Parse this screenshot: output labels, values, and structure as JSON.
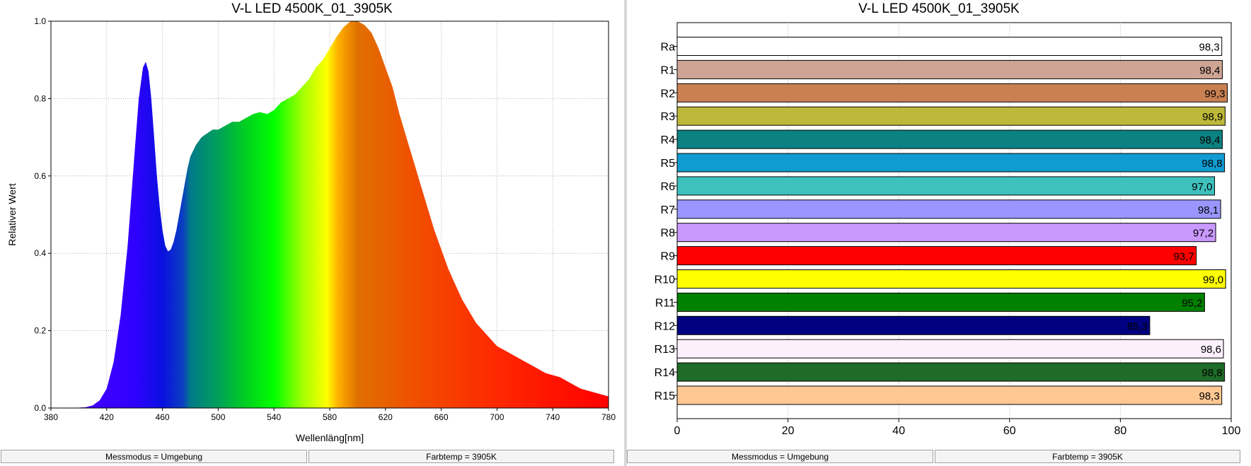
{
  "left": {
    "status1": "Messmodus = Umgebung",
    "status2": "Farbtemp = 3905K"
  },
  "right": {
    "status1": "Messmodus = Umgebung",
    "status2": "Farbtemp = 3905K"
  },
  "chart_data": [
    {
      "type": "area",
      "title": "V-L LED 4500K_01_3905K",
      "xlabel": "Wellenläng[nm]",
      "ylabel": "Relativer Wert",
      "xlim": [
        380,
        780
      ],
      "ylim": [
        0,
        1.0
      ],
      "xticks": [
        380,
        420,
        460,
        500,
        540,
        580,
        620,
        660,
        700,
        740,
        780
      ],
      "yticks": [
        "0.0",
        "0.2",
        "0.4",
        "0.6",
        "0.8",
        "1.0"
      ],
      "grid": true,
      "x": [
        380,
        395,
        405,
        410,
        415,
        420,
        425,
        430,
        435,
        440,
        443,
        446,
        448,
        450,
        452,
        454,
        456,
        458,
        460,
        462,
        464,
        466,
        468,
        470,
        472,
        474,
        476,
        478,
        480,
        484,
        488,
        492,
        496,
        500,
        505,
        510,
        515,
        520,
        525,
        530,
        535,
        540,
        545,
        550,
        555,
        560,
        565,
        570,
        575,
        580,
        585,
        590,
        595,
        600,
        605,
        610,
        615,
        620,
        625,
        630,
        635,
        640,
        645,
        650,
        655,
        660,
        665,
        670,
        675,
        680,
        685,
        690,
        695,
        700,
        705,
        710,
        715,
        720,
        725,
        730,
        735,
        740,
        745,
        750,
        755,
        760,
        765,
        770,
        775,
        780
      ],
      "values": [
        0.0,
        0.0,
        0.002,
        0.007,
        0.02,
        0.05,
        0.12,
        0.24,
        0.42,
        0.66,
        0.8,
        0.88,
        0.895,
        0.87,
        0.8,
        0.7,
        0.6,
        0.52,
        0.46,
        0.42,
        0.405,
        0.41,
        0.43,
        0.46,
        0.5,
        0.54,
        0.58,
        0.62,
        0.65,
        0.68,
        0.7,
        0.71,
        0.72,
        0.72,
        0.73,
        0.74,
        0.74,
        0.75,
        0.76,
        0.765,
        0.76,
        0.77,
        0.79,
        0.8,
        0.81,
        0.83,
        0.85,
        0.88,
        0.9,
        0.93,
        0.96,
        0.985,
        1.0,
        1.0,
        0.99,
        0.97,
        0.93,
        0.88,
        0.83,
        0.76,
        0.7,
        0.64,
        0.58,
        0.52,
        0.46,
        0.41,
        0.36,
        0.32,
        0.28,
        0.25,
        0.22,
        0.2,
        0.18,
        0.16,
        0.15,
        0.14,
        0.13,
        0.12,
        0.11,
        0.1,
        0.09,
        0.085,
        0.08,
        0.07,
        0.06,
        0.05,
        0.045,
        0.04,
        0.035,
        0.03
      ]
    },
    {
      "type": "bar",
      "orientation": "horizontal",
      "title": "V-L LED 4500K_01_3905K",
      "xlim": [
        0,
        100
      ],
      "xticks": [
        0,
        20,
        40,
        60,
        80,
        100
      ],
      "grid": true,
      "categories": [
        "Ra",
        "R1",
        "R2",
        "R3",
        "R4",
        "R5",
        "R6",
        "R7",
        "R8",
        "R9",
        "R10",
        "R11",
        "R12",
        "R13",
        "R14",
        "R15"
      ],
      "values": [
        98.3,
        98.4,
        99.3,
        98.9,
        98.4,
        98.8,
        97.0,
        98.1,
        97.2,
        93.7,
        99.0,
        95.2,
        85.3,
        98.6,
        98.8,
        98.3
      ],
      "labels": [
        "98,3",
        "98,4",
        "99,3",
        "98,9",
        "98,4",
        "98,8",
        "97,0",
        "98,1",
        "97,2",
        "93,7",
        "99,0",
        "95,2",
        "85,3",
        "98,6",
        "98,8",
        "98,3"
      ],
      "colors": [
        "#ffffff",
        "#cea595",
        "#c98052",
        "#bdb839",
        "#0b8182",
        "#109bd1",
        "#3ec1bd",
        "#9997ff",
        "#ca99ff",
        "#ff0000",
        "#ffff00",
        "#008000",
        "#000080",
        "#fdf0fd",
        "#1f6b28",
        "#ffc893"
      ]
    }
  ]
}
